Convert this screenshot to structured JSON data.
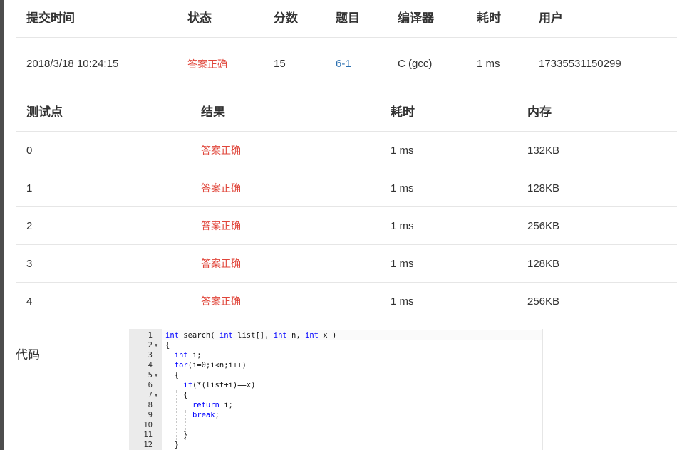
{
  "submission": {
    "headers": {
      "time": "提交时间",
      "status": "状态",
      "score": "分数",
      "problem": "题目",
      "compiler": "编译器",
      "time_used": "耗时",
      "user": "用户"
    },
    "row": {
      "time": "2018/3/18 10:24:15",
      "status": "答案正确",
      "score": "15",
      "problem": "6-1",
      "compiler": "C (gcc)",
      "time_used": "1 ms",
      "user": "17335531150299"
    }
  },
  "testcases": {
    "headers": {
      "id": "测试点",
      "result": "结果",
      "time": "耗时",
      "memory": "内存"
    },
    "rows": [
      {
        "id": "0",
        "result": "答案正确",
        "time": "1 ms",
        "memory": "132KB"
      },
      {
        "id": "1",
        "result": "答案正确",
        "time": "1 ms",
        "memory": "128KB"
      },
      {
        "id": "2",
        "result": "答案正确",
        "time": "1 ms",
        "memory": "256KB"
      },
      {
        "id": "3",
        "result": "答案正确",
        "time": "1 ms",
        "memory": "128KB"
      },
      {
        "id": "4",
        "result": "答案正确",
        "time": "1 ms",
        "memory": "256KB"
      }
    ]
  },
  "code": {
    "label": "代码",
    "lines": [
      {
        "n": "1",
        "text": "int search( int list[], int n, int x )",
        "fold": false
      },
      {
        "n": "2",
        "text": "{",
        "fold": true
      },
      {
        "n": "3",
        "text": "  int i;",
        "fold": false
      },
      {
        "n": "4",
        "text": "  for(i=0;i<n;i++)",
        "fold": false
      },
      {
        "n": "5",
        "text": "  {",
        "fold": true
      },
      {
        "n": "6",
        "text": "    if(*(list+i)==x)",
        "fold": false
      },
      {
        "n": "7",
        "text": "    {",
        "fold": true
      },
      {
        "n": "8",
        "text": "      return i;",
        "fold": false
      },
      {
        "n": "9",
        "text": "      break;",
        "fold": false
      },
      {
        "n": "10",
        "text": "",
        "fold": false
      },
      {
        "n": "11",
        "text": "    }",
        "fold": false
      },
      {
        "n": "12",
        "text": "  }",
        "fold": false
      }
    ]
  },
  "colors": {
    "success": "#e0453a",
    "link": "#2a6fb0",
    "keyword": "#0000ff"
  }
}
